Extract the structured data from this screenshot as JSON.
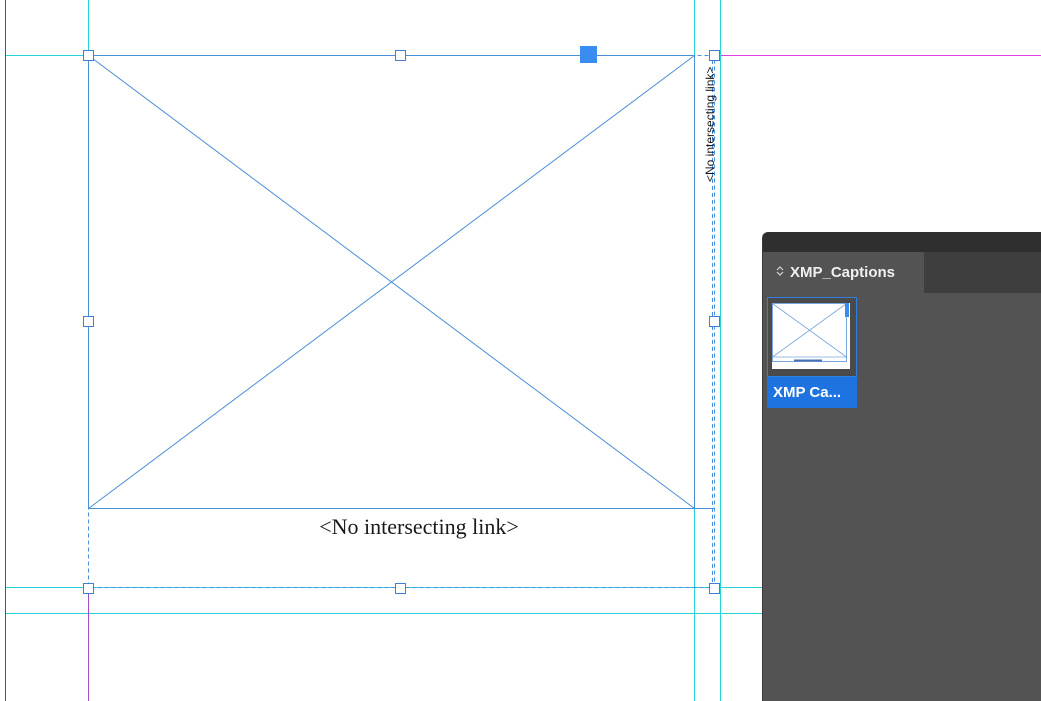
{
  "canvas": {
    "caption_text": "<No intersecting link>",
    "vertical_caption_text": "<No intersecting link>",
    "colors": {
      "guide_cyan": "#27d3d8",
      "frame_blue": "#4a8fd9",
      "margin_magenta": "#e040e0",
      "bleed_purple": "#9b4dca",
      "page_edge": "#555555"
    }
  },
  "panel": {
    "tab_icon": "collapse-arrows-icon",
    "tab_label": "XMP_Captions",
    "item": {
      "label": "XMP Ca...",
      "thumbnail_icon": "placeholder-frame-icon"
    },
    "colors": {
      "background": "#535353",
      "tabstrip": "#3e3e3e",
      "selection": "#1f73e0"
    }
  }
}
